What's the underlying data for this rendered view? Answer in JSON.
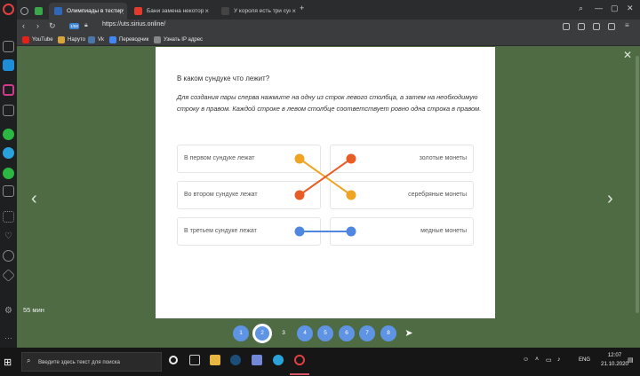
{
  "browser": {
    "tabs": [
      {
        "label": "Олимпиады в тестирующ",
        "active": true
      },
      {
        "label": "Бани замена некоторых",
        "active": false
      },
      {
        "label": "У короля есть три сундук",
        "active": false
      }
    ],
    "new_tab_icon": "plus-icon",
    "address": {
      "badge": "1/58",
      "url": "https://uts.sirius.online/"
    },
    "bookmarks": [
      "YouTube",
      "Наруто",
      "Vk",
      "Переводчик",
      "Узнать IP адрес"
    ]
  },
  "quiz": {
    "title": "В каком сундуке что лежит?",
    "instructions": "Для создания пары сперва нажмите на одну из строк левого столбца, а затем на необходимую строку в правом. Каждой строке в левом столбце соответствует ровно одна строка в правом.",
    "left_items": [
      "В первом сундуке лежат",
      "Во втором сундуке лежат",
      "В третьем сундуке лежат"
    ],
    "right_items": [
      "золотые монеты",
      "серебряные монеты",
      "медные монеты"
    ],
    "links": [
      {
        "from": 0,
        "to": 1,
        "left_color": "#f0a424",
        "right_color": "#f0a424"
      },
      {
        "from": 1,
        "to": 0,
        "left_color": "#e85d25",
        "right_color": "#e85d25"
      },
      {
        "from": 2,
        "to": 2,
        "left_color": "#4f86e0",
        "right_color": "#4f86e0"
      }
    ],
    "timer": "55 мин"
  },
  "pager": {
    "pages": [
      "1",
      "2",
      "3",
      "4",
      "5",
      "6",
      "7",
      "8"
    ],
    "current": "2",
    "unvisited": "3",
    "send_icon": "send-icon"
  },
  "taskbar": {
    "search_placeholder": "Введите здесь текст для поиска",
    "language": "ENG",
    "time": "12:07",
    "date": "21.10.2020"
  }
}
